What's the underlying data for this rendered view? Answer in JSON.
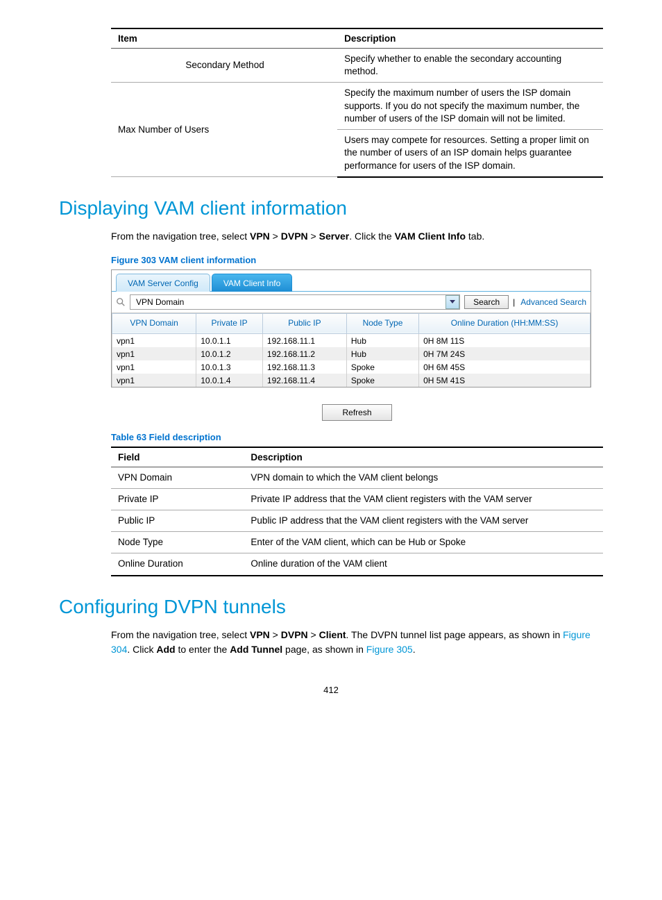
{
  "table_top": {
    "headers": {
      "item": "Item",
      "desc": "Description"
    },
    "rows": [
      {
        "item": "Secondary Method",
        "item_align": "center",
        "desc": "Specify whether to enable the secondary accounting method."
      },
      {
        "item": "Max Number of Users",
        "desc1": "Specify the maximum number of users the ISP domain supports. If you do not specify the maximum number, the number of users of the ISP domain will not be limited.",
        "desc2": "Users may compete for resources. Setting a proper limit on the number of users of an ISP domain helps guarantee performance for users of the ISP domain."
      }
    ]
  },
  "h1a": "Displaying VAM client information",
  "para1": {
    "pre": "From the navigation tree, select ",
    "b1": "VPN",
    "gt": " > ",
    "b2": "DVPN",
    "b3": "Server",
    "post1": ". Click the ",
    "b4": "VAM Client Info",
    "post2": " tab."
  },
  "fig303": "Figure 303 VAM client information",
  "ui": {
    "tabs": {
      "server": "VAM Server Config",
      "client": "VAM Client Info"
    },
    "select_label": "VPN Domain",
    "search_btn": "Search",
    "adv": "Advanced Search",
    "headers": {
      "domain": "VPN Domain",
      "priv": "Private IP",
      "pub": "Public IP",
      "node": "Node Type",
      "dur": "Online Duration (HH:MM:SS)"
    },
    "rows": [
      {
        "domain": "vpn1",
        "priv": "10.0.1.1",
        "pub": "192.168.11.1",
        "node": "Hub",
        "dur": "0H 8M 11S"
      },
      {
        "domain": "vpn1",
        "priv": "10.0.1.2",
        "pub": "192.168.11.2",
        "node": "Hub",
        "dur": "0H 7M 24S"
      },
      {
        "domain": "vpn1",
        "priv": "10.0.1.3",
        "pub": "192.168.11.3",
        "node": "Spoke",
        "dur": "0H 6M 45S"
      },
      {
        "domain": "vpn1",
        "priv": "10.0.1.4",
        "pub": "192.168.11.4",
        "node": "Spoke",
        "dur": "0H 5M 41S"
      }
    ],
    "refresh": "Refresh"
  },
  "tab63": {
    "caption": "Table 63 Field description",
    "headers": {
      "f": "Field",
      "d": "Description"
    },
    "rows": [
      {
        "f": "VPN Domain",
        "d": "VPN domain to which the VAM client belongs"
      },
      {
        "f": "Private IP",
        "d": "Private IP address that the VAM client registers with the VAM server"
      },
      {
        "f": "Public IP",
        "d": "Public IP address that the VAM client registers with the VAM server"
      },
      {
        "f": "Node Type",
        "d": "Enter of the VAM client, which can be Hub or Spoke"
      },
      {
        "f": "Online Duration",
        "d": "Online duration of the VAM client"
      }
    ]
  },
  "h1b": "Configuring DVPN tunnels",
  "para2": {
    "t1": "From the navigation tree, select ",
    "b1": "VPN",
    "gt": " > ",
    "b2": "DVPN",
    "b3": "Client",
    "t2": ". The DVPN tunnel list page appears, as shown in ",
    "l1": "Figure 304",
    "t3": ". Click ",
    "b4": "Add",
    "t4": " to enter the ",
    "b5": "Add Tunnel",
    "t5": " page, as shown in ",
    "l2": "Figure 305",
    "t6": "."
  },
  "pagenum": "412"
}
